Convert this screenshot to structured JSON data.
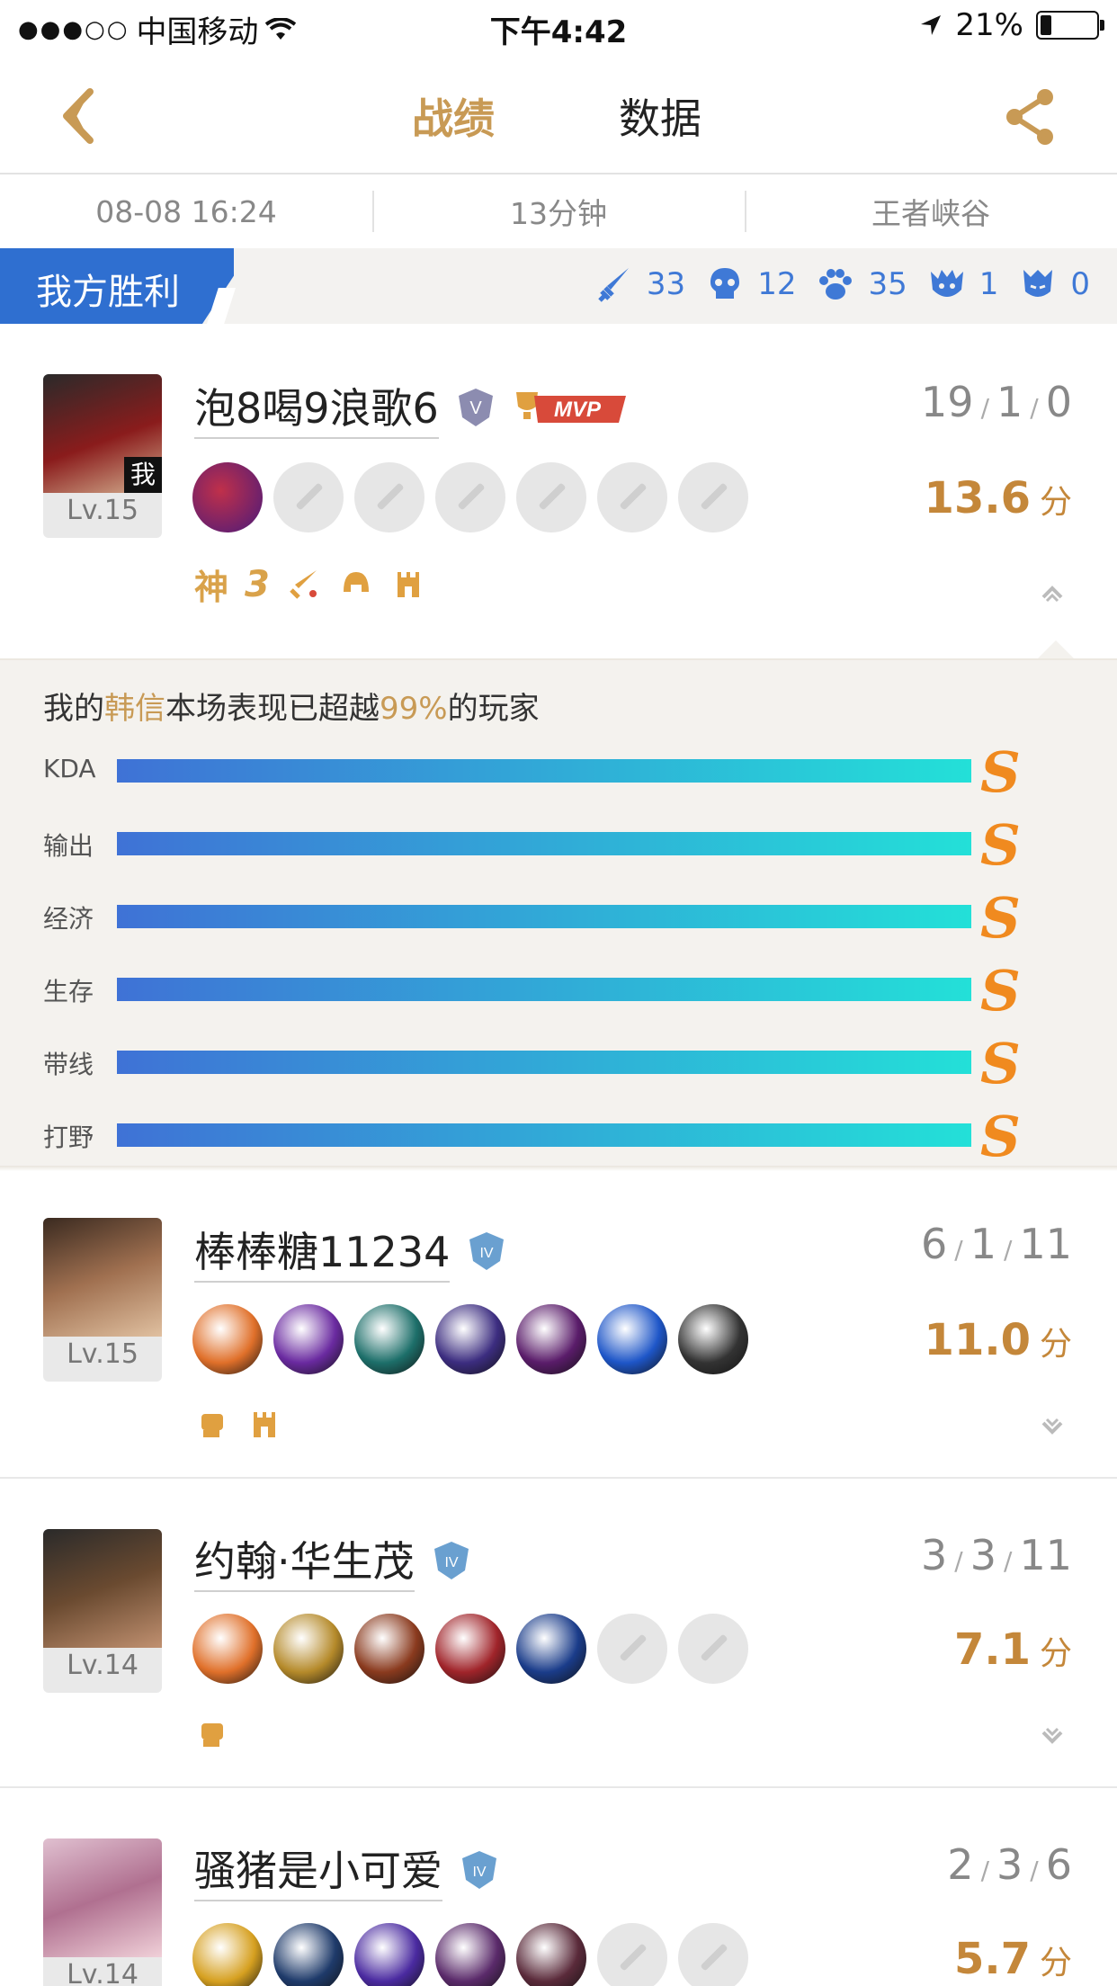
{
  "status_bar": {
    "signal": "●●●○○",
    "carrier": "中国移动",
    "time": "下午4:42",
    "battery": "21%"
  },
  "nav": {
    "tab_active": "战绩",
    "tab_inactive": "数据"
  },
  "match_info": {
    "datetime": "08-08 16:24",
    "duration": "13分钟",
    "map": "王者峡谷"
  },
  "team": {
    "result": "我方胜利",
    "stats": [
      {
        "icon": "kill-sword-icon",
        "value": "33"
      },
      {
        "icon": "death-skull-icon",
        "value": "12"
      },
      {
        "icon": "assist-paw-icon",
        "value": "35"
      },
      {
        "icon": "dragon-icon",
        "value": "1"
      },
      {
        "icon": "tyrant-icon",
        "value": "0"
      }
    ]
  },
  "players": [
    {
      "name": "泡8喝9浪歌6",
      "level": "Lv.15",
      "me_badge": "我",
      "rank": "V",
      "mvp": "MVP",
      "kda": [
        "19",
        "1",
        "0"
      ],
      "score": "13.6",
      "score_unit": "分",
      "badges": [
        "神",
        "3"
      ],
      "avatar_color": "#7a1c1c",
      "item_colors": [
        "#8a2bb0"
      ],
      "expanded": true
    },
    {
      "name": "棒棒糖11234",
      "level": "Lv.15",
      "rank": "IV",
      "kda": [
        "6",
        "1",
        "11"
      ],
      "score": "11.0",
      "score_unit": "分",
      "avatar_color": "#5b4a3a",
      "item_colors": [
        "#e0702a",
        "#6a2aa0",
        "#1d6f6a",
        "#3c2d80",
        "#5a1c6a",
        "#1e56c8",
        "#333333"
      ]
    },
    {
      "name": "约翰·华生茂",
      "level": "Lv.14",
      "rank": "IV",
      "kda": [
        "3",
        "3",
        "11"
      ],
      "score": "7.1",
      "score_unit": "分",
      "avatar_color": "#4a3a30",
      "item_colors": [
        "#e0702a",
        "#b58a2a",
        "#8a3a1e",
        "#a0242a",
        "#1a3c8a"
      ]
    },
    {
      "name": "骚猪是小可爱",
      "level": "Lv.14",
      "rank": "IV",
      "kda": [
        "2",
        "3",
        "6"
      ],
      "score": "5.7",
      "score_unit": "分",
      "avatar_color": "#c89ab0",
      "item_colors": [
        "#d6a020",
        "#1e3a6a",
        "#4a2aa0",
        "#5a2a6a",
        "#5a2a3a"
      ]
    }
  ],
  "performance": {
    "prefix": "我的",
    "hero": "韩信",
    "middle": "本场表现已超越",
    "percent": "99%",
    "suffix": "的玩家",
    "rows": [
      {
        "label": "KDA",
        "grade": "S"
      },
      {
        "label": "输出",
        "grade": "S"
      },
      {
        "label": "经济",
        "grade": "S"
      },
      {
        "label": "生存",
        "grade": "S"
      },
      {
        "label": "带线",
        "grade": "S"
      },
      {
        "label": "打野",
        "grade": "S"
      }
    ]
  },
  "colors": {
    "accent_gold": "#c89a55",
    "win_blue": "#2f6fd0",
    "stat_blue": "#3f79d6",
    "grade_orange": "#f08a1f"
  }
}
